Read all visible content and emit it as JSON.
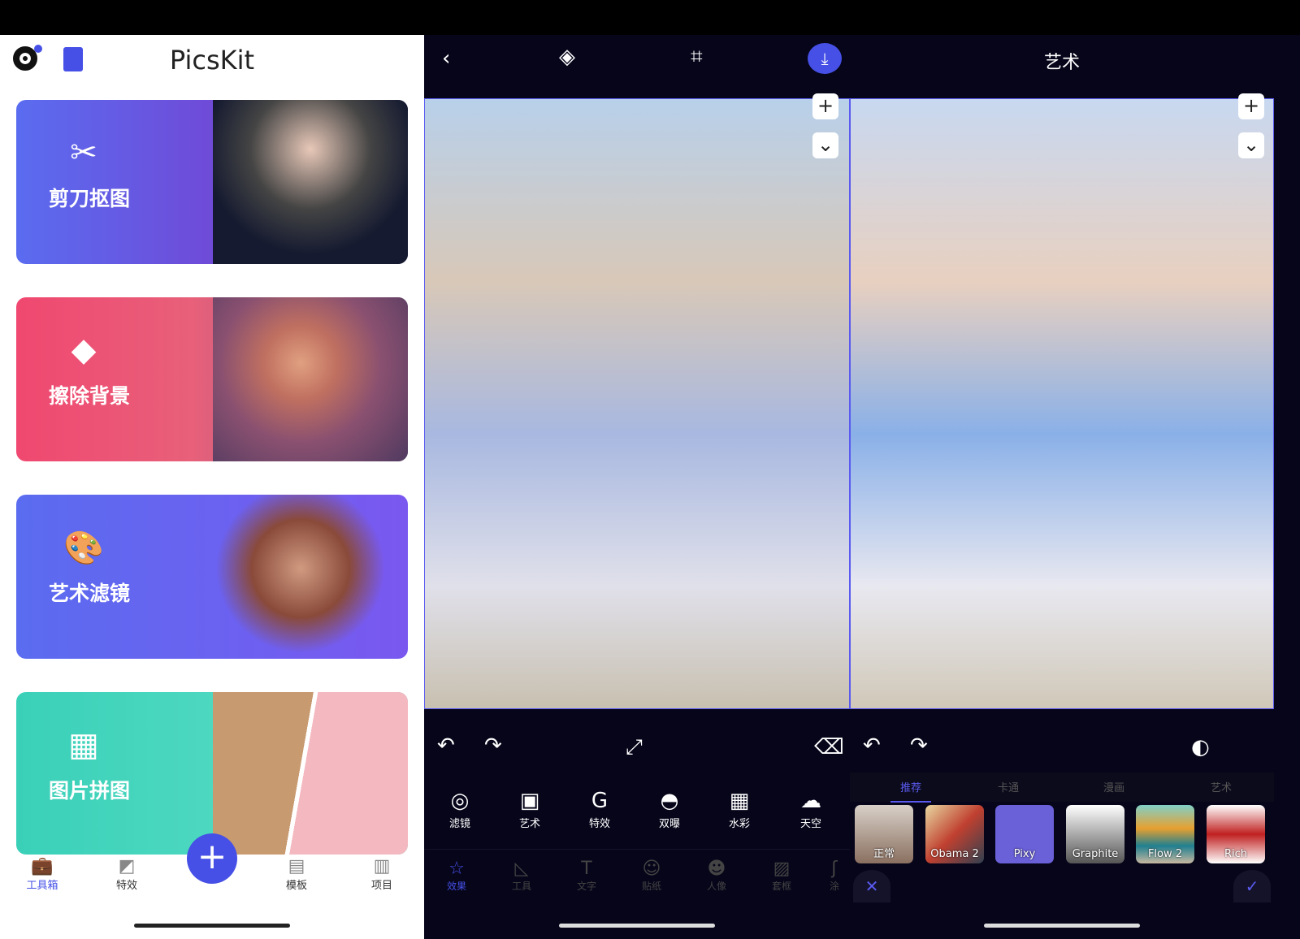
{
  "home": {
    "title": "PicsKit",
    "cards": [
      {
        "label": "剪刀抠图",
        "icon": "scissors-icon"
      },
      {
        "label": "擦除背景",
        "icon": "eraser-icon"
      },
      {
        "label": "艺术滤镜",
        "icon": "palette-icon"
      },
      {
        "label": "图片拼图",
        "icon": "collage-icon"
      }
    ],
    "nav": [
      {
        "label": "工具箱",
        "active": true
      },
      {
        "label": "特效"
      },
      {
        "label": "模板"
      },
      {
        "label": "项目"
      }
    ],
    "accent": "#4650e6"
  },
  "editor": {
    "tools": [
      "滤镜",
      "艺术",
      "特效",
      "双曝",
      "水彩",
      "天空"
    ],
    "tabs": [
      "效果",
      "工具",
      "文字",
      "贴纸",
      "人像",
      "套框",
      "涂"
    ]
  },
  "art": {
    "title": "艺术",
    "categories": [
      "推荐",
      "卡通",
      "漫画",
      "艺术"
    ],
    "filters": [
      "正常",
      "Obama 2",
      "Pixy",
      "Graphite",
      "Flow 2",
      "Rich"
    ]
  }
}
